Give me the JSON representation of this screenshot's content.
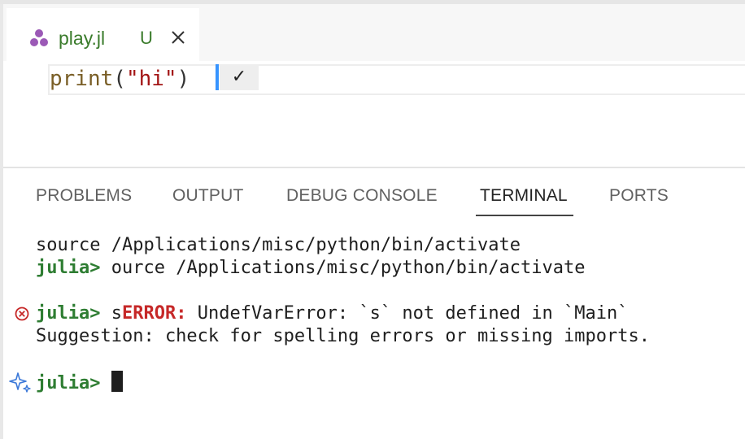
{
  "editor_tab": {
    "filename": "play.jl",
    "status": "U",
    "icon": "julia-dots-icon"
  },
  "editor": {
    "code": {
      "fn": "print",
      "open": "(",
      "str": "\"hi\"",
      "close": ")"
    },
    "cell_status": "✓"
  },
  "panel": {
    "tabs": [
      {
        "label": "PROBLEMS"
      },
      {
        "label": "OUTPUT"
      },
      {
        "label": "DEBUG CONSOLE"
      },
      {
        "label": "TERMINAL",
        "active": true
      },
      {
        "label": "PORTS"
      }
    ]
  },
  "terminal": {
    "line1": "source /Applications/misc/python/bin/activate",
    "line2_prompt": "julia>",
    "line2_text": " ource /Applications/misc/python/bin/activate",
    "line3_prompt": "julia>",
    "line3_input": " s",
    "line3_error_label": "ERROR:",
    "line3_error_msg": " UndefVarError: `s` not defined in `Main`",
    "line4": "Suggestion: check for spelling errors or missing imports.",
    "line5_prompt": "julia>"
  },
  "colors": {
    "julia_green": "#2e7d32",
    "error_red": "#c62828",
    "accent_blue": "#3794ff"
  }
}
